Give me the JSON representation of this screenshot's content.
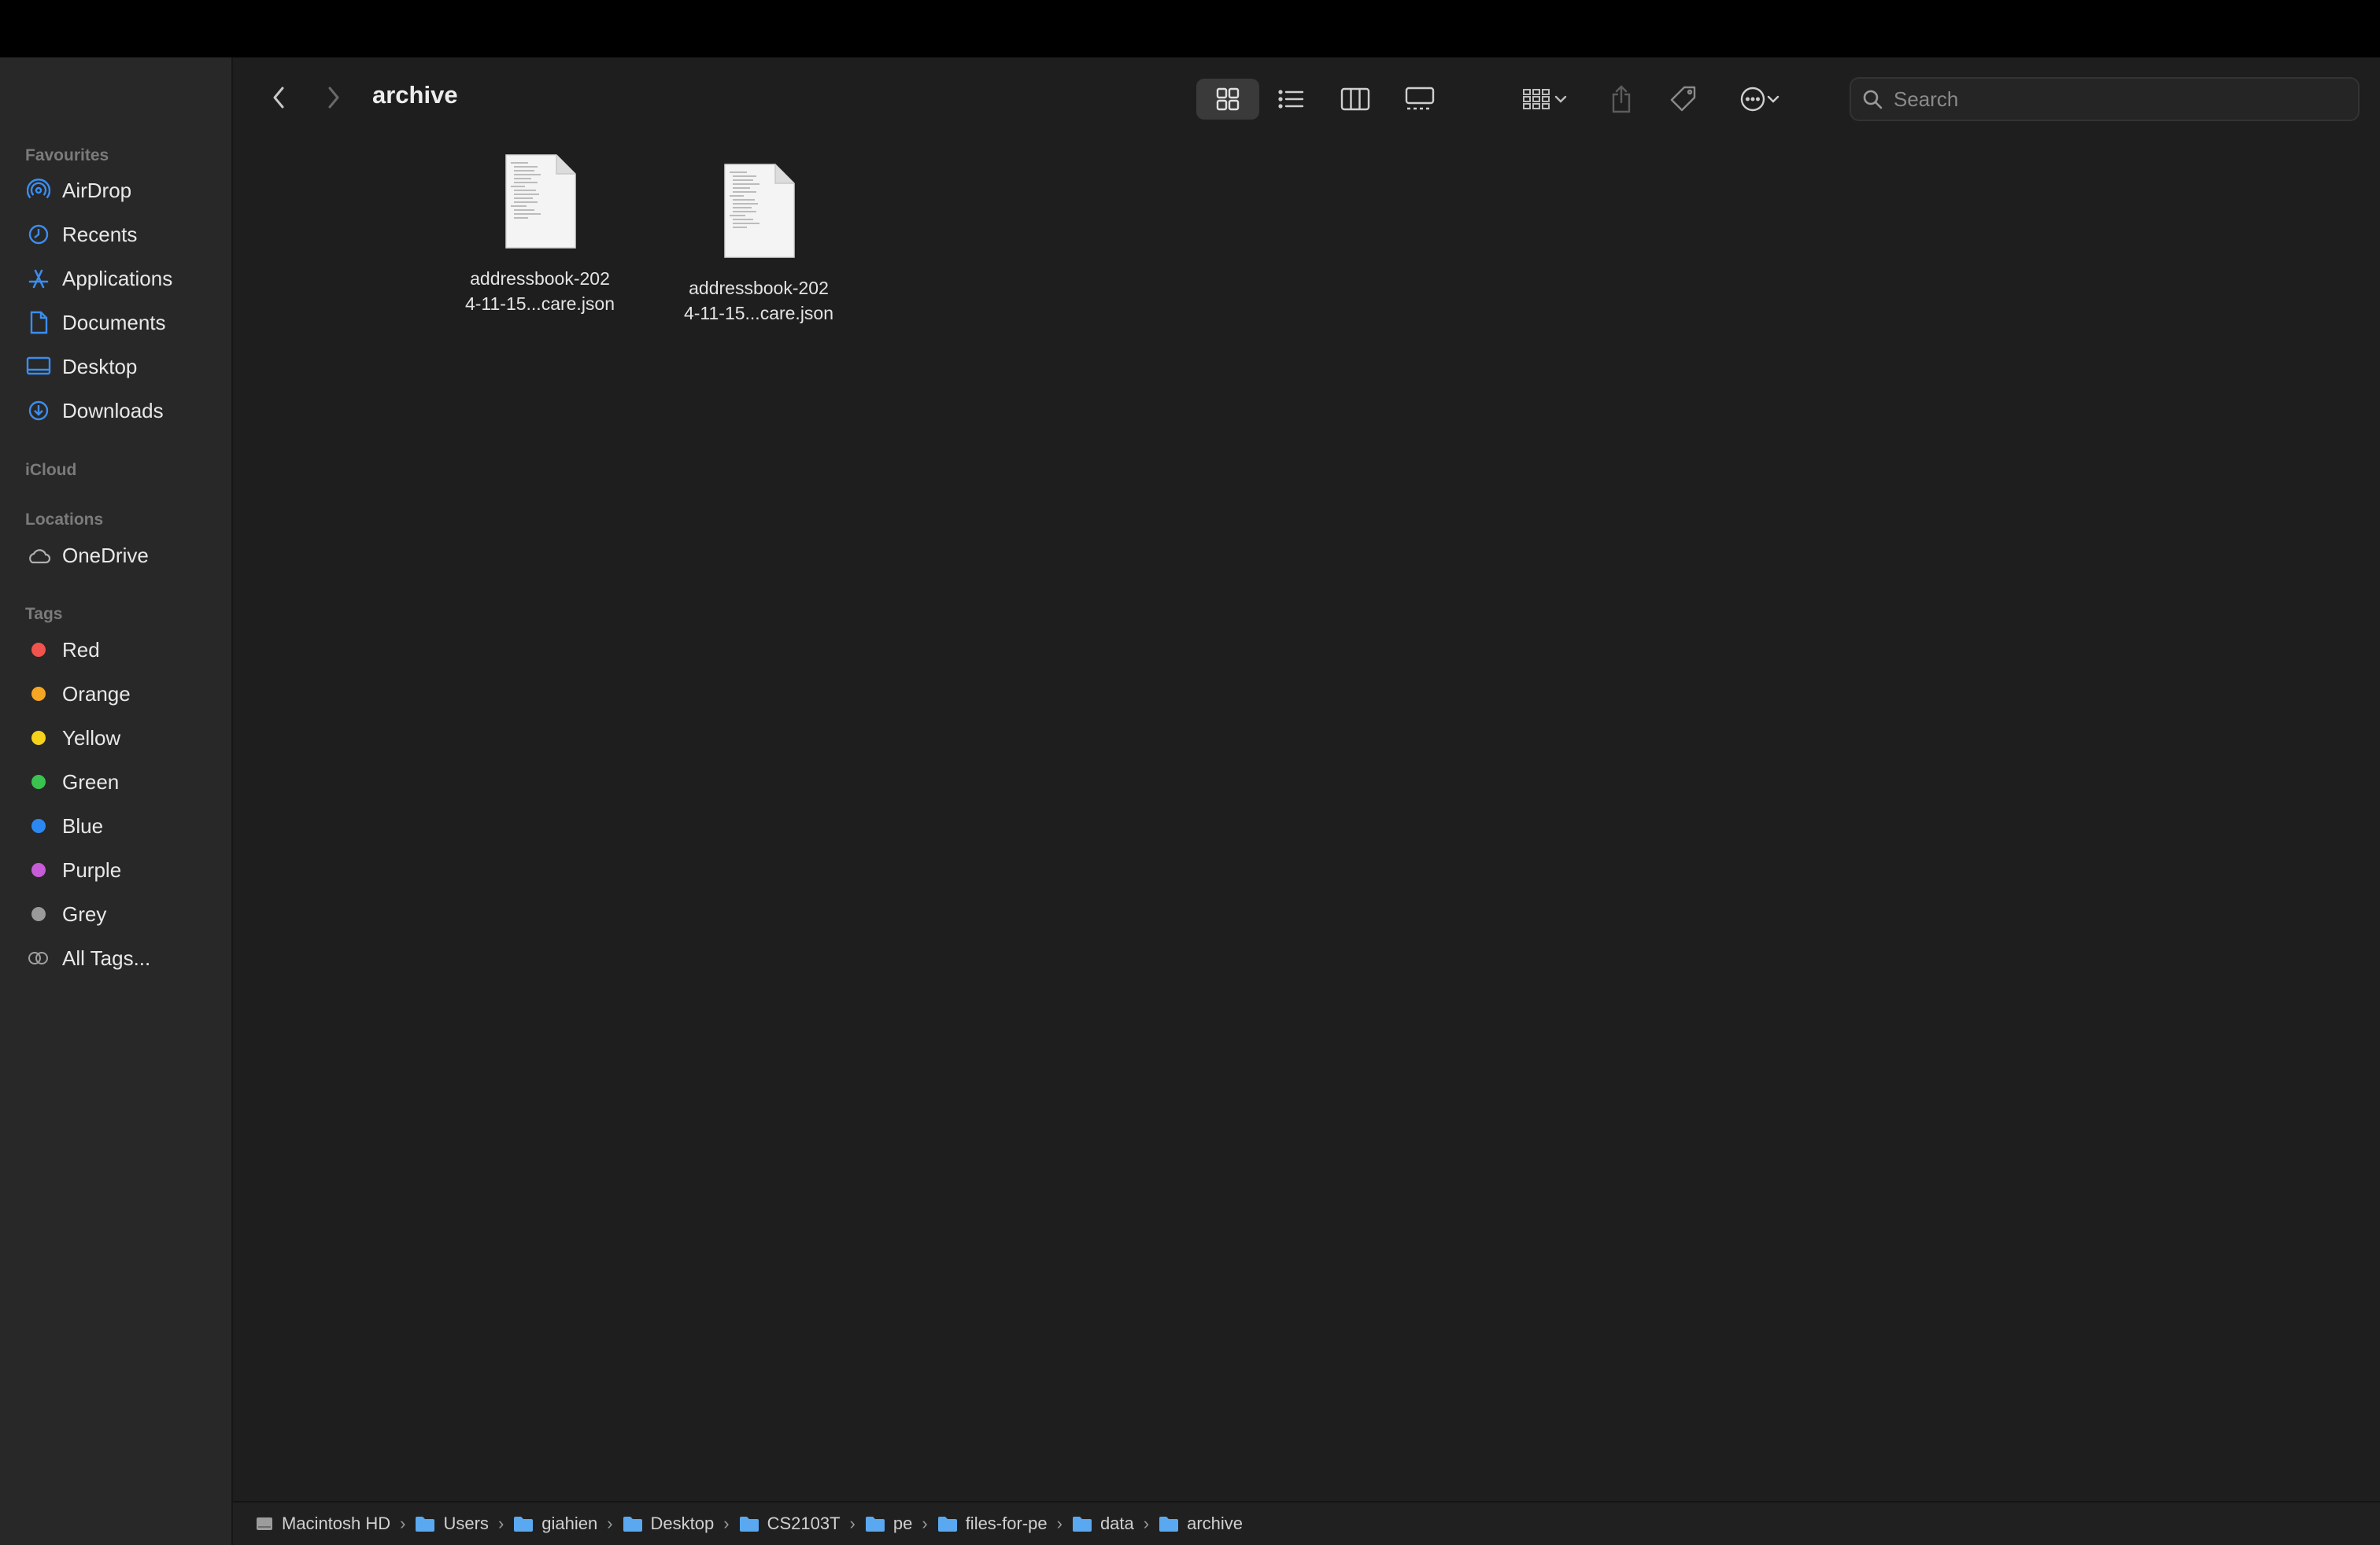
{
  "window": {
    "title": "archive"
  },
  "toolbar": {
    "back_icon": "chevron-left-icon",
    "forward_icon": "chevron-right-icon",
    "views": [
      "icon-view",
      "list-view",
      "column-view",
      "gallery-view"
    ],
    "active_view": "icon-view",
    "search_placeholder": "Search"
  },
  "sidebar": {
    "favourites_label": "Favourites",
    "favourites": [
      {
        "label": "AirDrop",
        "icon": "airdrop-icon"
      },
      {
        "label": "Recents",
        "icon": "clock-icon"
      },
      {
        "label": "Applications",
        "icon": "applications-icon"
      },
      {
        "label": "Documents",
        "icon": "document-icon"
      },
      {
        "label": "Desktop",
        "icon": "desktop-icon"
      },
      {
        "label": "Downloads",
        "icon": "download-icon"
      }
    ],
    "icloud_label": "iCloud",
    "locations_label": "Locations",
    "locations": [
      {
        "label": "OneDrive",
        "icon": "cloud-icon"
      }
    ],
    "tags_label": "Tags",
    "tags": [
      {
        "label": "Red",
        "color": "#f0544c"
      },
      {
        "label": "Orange",
        "color": "#f5a623"
      },
      {
        "label": "Yellow",
        "color": "#f7d21c"
      },
      {
        "label": "Green",
        "color": "#3ac34f"
      },
      {
        "label": "Blue",
        "color": "#2b88f2"
      },
      {
        "label": "Purple",
        "color": "#c65cd8"
      },
      {
        "label": "Grey",
        "color": "#9a9a9a"
      }
    ],
    "all_tags_label": "All Tags..."
  },
  "files": [
    {
      "name_line1": "addressbook-202",
      "name_line2": "4-11-15...care.json"
    },
    {
      "name_line1": "addressbook-202",
      "name_line2": "4-11-15...care.json"
    }
  ],
  "path": [
    "Macintosh HD",
    "Users",
    "giahien",
    "Desktop",
    "CS2103T",
    "pe",
    "files-for-pe",
    "data",
    "archive"
  ],
  "colors": {
    "accent": "#3b8df0",
    "folder": "#5aa8f0"
  }
}
